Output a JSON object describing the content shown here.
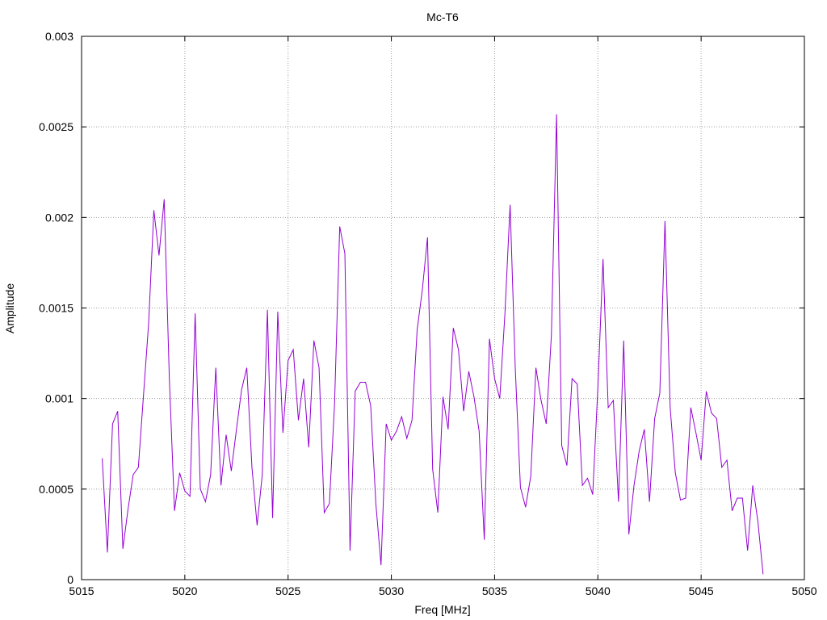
{
  "chart_data": {
    "type": "line",
    "title": "Mc-T6",
    "xlabel": "Freq [MHz]",
    "ylabel": "Amplitude",
    "xlim": [
      5015,
      5050
    ],
    "ylim": [
      0,
      0.003
    ],
    "xticks": [
      5015,
      5020,
      5025,
      5030,
      5035,
      5040,
      5045,
      5050
    ],
    "xtick_labels": [
      "5015",
      "5020",
      "5025",
      "5030",
      "5035",
      "5040",
      "5045",
      "5050"
    ],
    "yticks": [
      0,
      0.0005,
      0.001,
      0.0015,
      0.002,
      0.0025,
      0.003
    ],
    "ytick_labels": [
      "0",
      "0.0005",
      "0.001",
      "0.0015",
      "0.002",
      "0.0025",
      "0.003"
    ],
    "grid": true,
    "line_color": "#9400d3",
    "series": [
      {
        "x": [
          5016.0,
          5016.25,
          5016.5,
          5016.75,
          5017.0,
          5017.25,
          5017.5,
          5017.75,
          5018.0,
          5018.25,
          5018.5,
          5018.75,
          5019.0,
          5019.25,
          5019.5,
          5019.75,
          5020.0,
          5020.25,
          5020.5,
          5020.75,
          5021.0,
          5021.25,
          5021.5,
          5021.75,
          5022.0,
          5022.25,
          5022.5,
          5022.75,
          5023.0,
          5023.25,
          5023.5,
          5023.75,
          5024.0,
          5024.25,
          5024.5,
          5024.75,
          5025.0,
          5025.25,
          5025.5,
          5025.75,
          5026.0,
          5026.25,
          5026.5,
          5026.75,
          5027.0,
          5027.25,
          5027.5,
          5027.75,
          5028.0,
          5028.25,
          5028.5,
          5028.75,
          5029.0,
          5029.25,
          5029.5,
          5029.75,
          5030.0,
          5030.25,
          5030.5,
          5030.75,
          5031.0,
          5031.25,
          5031.5,
          5031.75,
          5032.0,
          5032.25,
          5032.5,
          5032.75,
          5033.0,
          5033.25,
          5033.5,
          5033.75,
          5034.0,
          5034.25,
          5034.5,
          5034.75,
          5035.0,
          5035.25,
          5035.5,
          5035.75,
          5036.0,
          5036.25,
          5036.5,
          5036.75,
          5037.0,
          5037.25,
          5037.5,
          5037.75,
          5038.0,
          5038.25,
          5038.5,
          5038.75,
          5039.0,
          5039.25,
          5039.5,
          5039.75,
          5040.0,
          5040.25,
          5040.5,
          5040.75,
          5041.0,
          5041.25,
          5041.5,
          5041.75,
          5042.0,
          5042.25,
          5042.5,
          5042.75,
          5043.0,
          5043.25,
          5043.5,
          5043.75,
          5044.0,
          5044.25,
          5044.5,
          5044.75,
          5045.0,
          5045.25,
          5045.5,
          5045.75,
          5046.0,
          5046.25,
          5046.5,
          5046.75,
          5047.0,
          5047.25,
          5047.5,
          5047.75,
          5048.0
        ],
        "y": [
          0.00067,
          0.00015,
          0.00086,
          0.00093,
          0.00017,
          0.00039,
          0.00058,
          0.00062,
          0.00102,
          0.00142,
          0.00204,
          0.00179,
          0.0021,
          0.00111,
          0.00038,
          0.00059,
          0.00049,
          0.00046,
          0.00147,
          0.0005,
          0.00043,
          0.00058,
          0.00117,
          0.00052,
          0.0008,
          0.0006,
          0.00083,
          0.00105,
          0.00117,
          0.00062,
          0.0003,
          0.00058,
          0.00149,
          0.00034,
          0.00148,
          0.00081,
          0.00121,
          0.00127,
          0.00088,
          0.00111,
          0.00073,
          0.00132,
          0.00117,
          0.00037,
          0.00042,
          0.00097,
          0.00195,
          0.0018,
          0.00016,
          0.00104,
          0.00109,
          0.00109,
          0.00096,
          0.00042,
          8e-05,
          0.00086,
          0.00077,
          0.00082,
          0.0009,
          0.00078,
          0.00088,
          0.00138,
          0.0016,
          0.00189,
          0.00061,
          0.00037,
          0.00101,
          0.00083,
          0.00139,
          0.00127,
          0.00093,
          0.00115,
          0.00101,
          0.00082,
          0.00022,
          0.00133,
          0.00111,
          0.001,
          0.00147,
          0.00207,
          0.00117,
          0.00051,
          0.0004,
          0.00057,
          0.00117,
          0.00099,
          0.00086,
          0.00135,
          0.00257,
          0.00074,
          0.00063,
          0.00111,
          0.00108,
          0.00052,
          0.00056,
          0.00047,
          0.00106,
          0.00177,
          0.00095,
          0.00099,
          0.00043,
          0.00132,
          0.00025,
          0.00052,
          0.00071,
          0.00083,
          0.00043,
          0.00089,
          0.00103,
          0.00198,
          0.00095,
          0.00059,
          0.00044,
          0.00045,
          0.00095,
          0.00081,
          0.00066,
          0.00104,
          0.00092,
          0.00089,
          0.00062,
          0.00066,
          0.00038,
          0.00045,
          0.00045,
          0.00016,
          0.00052,
          0.00032,
          3e-05
        ]
      }
    ]
  }
}
